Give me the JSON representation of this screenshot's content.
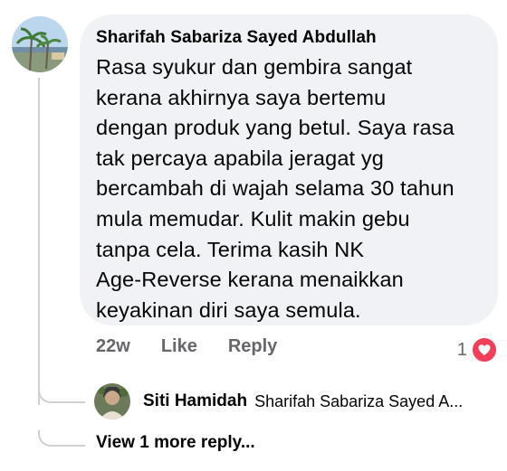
{
  "comment": {
    "author": "Sharifah Sabariza Sayed Abdullah",
    "text": "Rasa syukur dan gembira sangat\nkerana akhirnya saya bertemu\ndengan produk yang betul. Saya rasa\ntak percaya apabila jeragat yg\nbercambah di wajah selama 30 tahun\nmula memudar. Kulit makin gebu\ntanpa cela. Terima kasih NK\nAge-Reverse kerana menaikkan\nkeyakinan diri saya semula.",
    "time": "22w",
    "like_label": "Like",
    "reply_label": "Reply",
    "reaction_count": "1",
    "reaction_icon": "heart-icon"
  },
  "reply": {
    "author": "Siti Hamidah",
    "snippet": "Sharifah Sabariza Sayed A..."
  },
  "more_replies_label": "View 1 more reply...",
  "colors": {
    "bubble": "#f0f2f5",
    "meta_text": "#65676b",
    "heart": "#f33e58",
    "thread_line": "#ced0d4"
  }
}
